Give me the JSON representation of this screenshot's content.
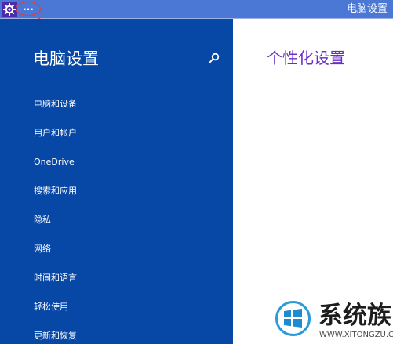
{
  "window": {
    "title": "电脑设置",
    "more_label": "···"
  },
  "sidebar": {
    "title": "电脑设置",
    "items": [
      {
        "label": "电脑和设备"
      },
      {
        "label": "用户和帐户"
      },
      {
        "label": "OneDrive"
      },
      {
        "label": "搜索和应用"
      },
      {
        "label": "隐私"
      },
      {
        "label": "网络"
      },
      {
        "label": "时间和语言"
      },
      {
        "label": "轻松使用"
      },
      {
        "label": "更新和恢复"
      }
    ]
  },
  "main": {
    "title": "个性化设置"
  },
  "watermark": {
    "brand": "系统族",
    "url": "WWW.XITONGZU.COM"
  },
  "icons": {
    "settings": "gear-icon",
    "search": "search-icon",
    "windows": "windows-logo-icon"
  },
  "colors": {
    "titlebar": "#4a78d4",
    "sidebar": "#0747a6",
    "accent": "#6a2fc8",
    "annotation": "#e33a3a"
  }
}
